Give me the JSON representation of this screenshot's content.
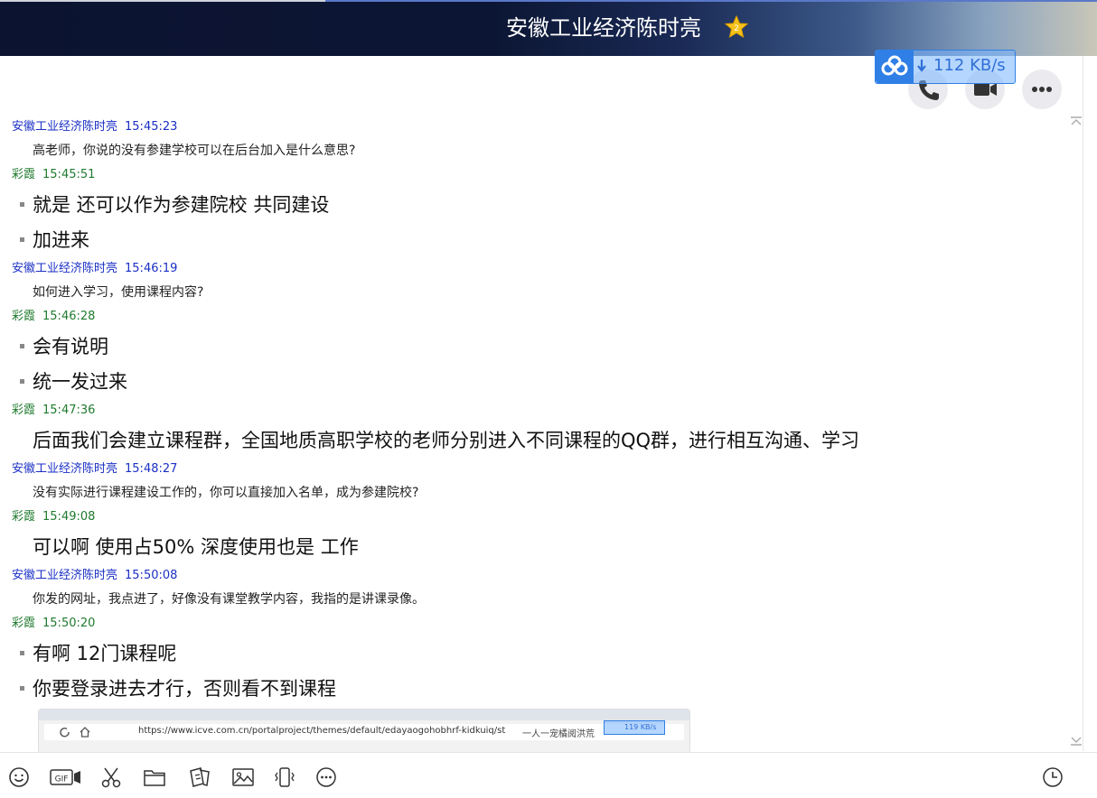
{
  "window": {
    "title": "安徽工业经济陈时亮",
    "star_badge": "2"
  },
  "download_speed": {
    "value": "112 KB/s"
  },
  "header_actions": [
    "voice-call",
    "video-call",
    "more"
  ],
  "messages": [
    {
      "sender": "安徽工业经济陈时亮",
      "time": "15:45:23",
      "lines": [
        "高老师，你说的没有参建学校可以在后台加入是什么意思?"
      ]
    },
    {
      "sender": "彩霞",
      "time": "15:45:51",
      "lines": [
        "就是 还可以作为参建院校 共同建设",
        "加进来"
      ]
    },
    {
      "sender": "安徽工业经济陈时亮",
      "time": "15:46:19",
      "lines": [
        "如何进入学习，使用课程内容?"
      ]
    },
    {
      "sender": "彩霞",
      "time": "15:46:28",
      "lines": [
        "会有说明",
        "统一发过来"
      ]
    },
    {
      "sender": "彩霞",
      "time": "15:47:36",
      "lines": [
        "后面我们会建立课程群，全国地质高职学校的老师分别进入不同课程的QQ群，进行相互沟通、学习"
      ]
    },
    {
      "sender": "安徽工业经济陈时亮",
      "time": "15:48:27",
      "lines": [
        "没有实际进行课程建设工作的，你可以直接加入名单，成为参建院校?"
      ]
    },
    {
      "sender": "彩霞",
      "time": "15:49:08",
      "lines": [
        "可以啊 使用占50% 深度使用也是 工作"
      ]
    },
    {
      "sender": "安徽工业经济陈时亮",
      "time": "15:50:08",
      "lines": [
        "你发的网址，我点进了，好像没有课堂教学内容，我指的是讲课录像。"
      ]
    },
    {
      "sender": "彩霞",
      "time": "15:50:20",
      "lines": [
        "有啊  12门课程呢",
        "你要登录进去才行，否则看不到课程"
      ]
    }
  ],
  "screenshot_preview": {
    "url": "https://www.icve.com.cn/portalproject/themes/default/edayaogohobhrf-kidkuiq/st",
    "side_text": "一人一宠橘阅洪荒",
    "speed": "119 KB/s"
  },
  "toolbar": [
    "emoji-icon",
    "gif-icon",
    "scissors-icon",
    "folder-icon",
    "file-share-icon",
    "image-icon",
    "shake-icon",
    "more-icon",
    "history-icon"
  ]
}
